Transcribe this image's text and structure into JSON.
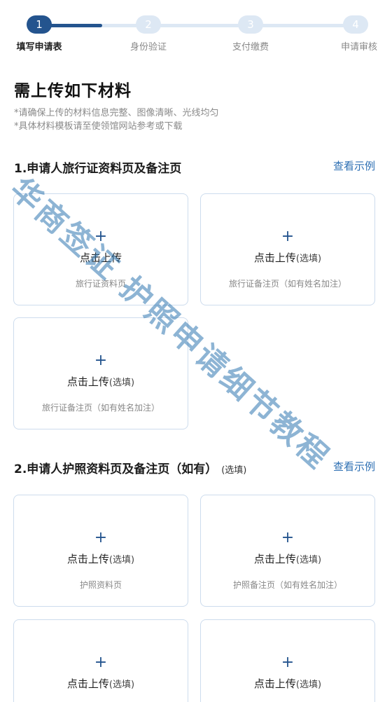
{
  "stepper": {
    "steps": [
      {
        "number": "1",
        "label": "填写申请表"
      },
      {
        "number": "2",
        "label": "身份验证"
      },
      {
        "number": "3",
        "label": "支付缴费"
      },
      {
        "number": "4",
        "label": "申请审核"
      }
    ],
    "current_step": 1,
    "colors": {
      "active": "#24548e",
      "inactive": "#dde8f4"
    }
  },
  "intro": {
    "title": "需上传如下材料",
    "notes": [
      "*请确保上传的材料信息完整、图像清晰、光线均匀",
      "*具体材料模板请至使领馆网站参考或下载"
    ]
  },
  "sections": [
    {
      "title": "1.申请人旅行证资料页及备注页",
      "optional_tag": "",
      "sample_link": "查看示例",
      "cards": [
        {
          "icon": "plus-icon",
          "upload_label": "点击上传",
          "optional": "",
          "desc": "旅行证资料页"
        },
        {
          "icon": "plus-icon",
          "upload_label": "点击上传",
          "optional": "(选填)",
          "desc": "旅行证备注页（如有姓名加注）"
        },
        {
          "icon": "plus-icon",
          "upload_label": "点击上传",
          "optional": "(选填)",
          "desc": "旅行证备注页（如有姓名加注）"
        }
      ]
    },
    {
      "title": "2.申请人护照资料页及备注页（如有）",
      "optional_tag": "(选填)",
      "sample_link": "查看示例",
      "cards": [
        {
          "icon": "plus-icon",
          "upload_label": "点击上传",
          "optional": "(选填)",
          "desc": "护照资料页"
        },
        {
          "icon": "plus-icon",
          "upload_label": "点击上传",
          "optional": "(选填)",
          "desc": "护照备注页（如有姓名加注）"
        },
        {
          "icon": "plus-icon",
          "upload_label": "点击上传",
          "optional": "(选填)",
          "desc": ""
        },
        {
          "icon": "plus-icon",
          "upload_label": "点击上传",
          "optional": "(选填)",
          "desc": ""
        }
      ]
    }
  ],
  "watermark": "华商签证 护照申请细节教程",
  "colors": {
    "accent": "#24548e",
    "link": "#2d6fb3",
    "card_border": "#cddced",
    "watermark": "#2f76b0"
  }
}
